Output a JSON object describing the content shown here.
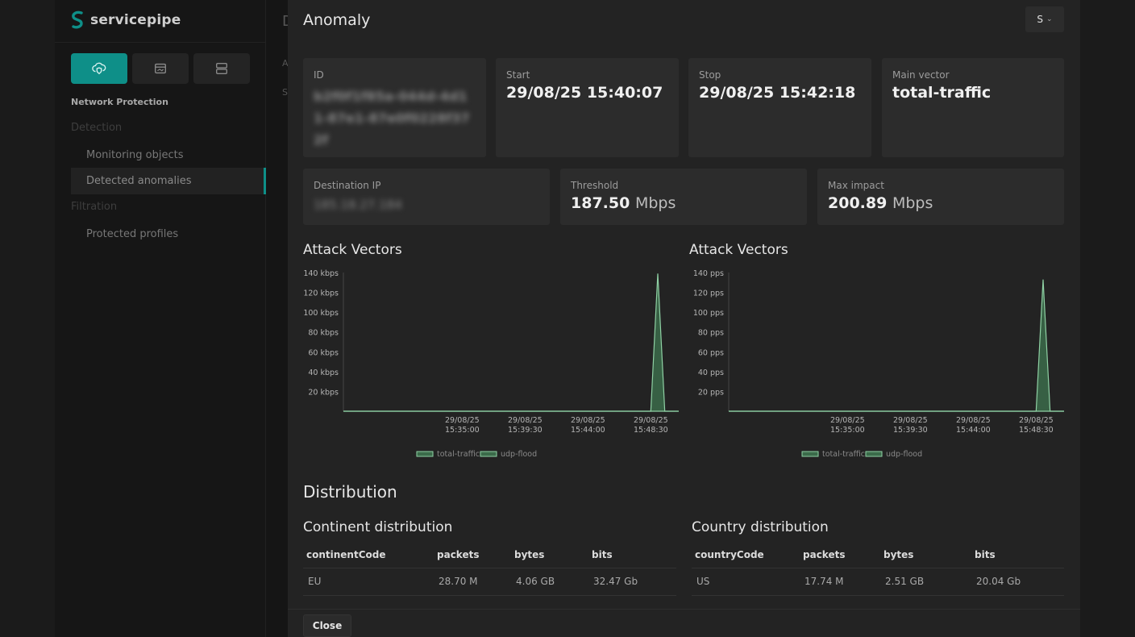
{
  "app": {
    "name": "servicepipe"
  },
  "sidebar": {
    "section_title": "Network Protection",
    "groups": [
      {
        "label": "Detection"
      },
      {
        "label": "Filtration"
      }
    ],
    "items": [
      {
        "label": "Monitoring objects",
        "active": false
      },
      {
        "label": "Detected anomalies",
        "active": true
      },
      {
        "label": "Protected profiles",
        "active": false
      }
    ],
    "nav_icons": [
      "cloud-shield-icon",
      "browser-window-icon",
      "server-icon"
    ]
  },
  "underlay": {
    "title_char": "D",
    "row_chars": [
      "A",
      "S"
    ]
  },
  "modal": {
    "title": "Anomaly",
    "user_initial": "S",
    "cards": {
      "id": {
        "label": "ID",
        "value": "b2f0f1f85a-044d-4d11-87e1-87e0f0228f372f"
      },
      "start": {
        "label": "Start",
        "value": "29/08/25 15:40:07"
      },
      "stop": {
        "label": "Stop",
        "value": "29/08/25 15:42:18"
      },
      "main_vector": {
        "label": "Main vector",
        "value": "total-traffic"
      },
      "destination_ip": {
        "label": "Destination IP",
        "value": "185.18.27.184"
      },
      "threshold": {
        "label": "Threshold",
        "value": "187.50",
        "unit": "Mbps"
      },
      "max_impact": {
        "label": "Max impact",
        "value": "200.89",
        "unit": "Mbps"
      }
    },
    "charts_title_left": "Attack Vectors",
    "charts_title_right": "Attack Vectors",
    "distribution_title": "Distribution",
    "continent": {
      "title": "Continent distribution",
      "columns": [
        "continentCode",
        "packets",
        "bytes",
        "bits"
      ],
      "rows": [
        [
          "EU",
          "28.70 M",
          "4.06 GB",
          "32.47 Gb"
        ]
      ]
    },
    "country": {
      "title": "Country distribution",
      "columns": [
        "countryCode",
        "packets",
        "bytes",
        "bits"
      ],
      "rows": [
        [
          "US",
          "17.74 M",
          "2.51 GB",
          "20.04 Gb"
        ]
      ]
    },
    "close_label": "Close"
  },
  "colors": {
    "accent": "#0e8f88",
    "series": "#8fd1a4",
    "series_fill": "#3b6b4a"
  },
  "chart_data": [
    {
      "type": "area",
      "title": "Attack Vectors",
      "unit": "kbps",
      "ylim": [
        0,
        140
      ],
      "y_ticks": [
        "20 kbps",
        "40 kbps",
        "60 kbps",
        "80 kbps",
        "100 kbps",
        "120 kbps",
        "140 kbps"
      ],
      "x_ticks": [
        [
          "29/08/25",
          "15:35:00"
        ],
        [
          "29/08/25",
          "15:39:30"
        ],
        [
          "29/08/25",
          "15:44:00"
        ],
        [
          "29/08/25",
          "15:48:30"
        ]
      ],
      "x_range_minutes": [
        -8.5,
        15.5
      ],
      "series": [
        {
          "name": "total-traffic",
          "points": [
            [
              -8.5,
              0
            ],
            [
              13.5,
              0
            ],
            [
              14.0,
              139
            ],
            [
              14.5,
              0
            ],
            [
              15.5,
              0
            ]
          ]
        },
        {
          "name": "udp-flood",
          "points": [
            [
              -8.5,
              0
            ],
            [
              15.5,
              0
            ]
          ]
        }
      ],
      "legend": "bottom-center"
    },
    {
      "type": "area",
      "title": "Attack Vectors",
      "unit": "pps",
      "ylim": [
        0,
        140
      ],
      "y_ticks": [
        "20 pps",
        "40 pps",
        "60 pps",
        "80 pps",
        "100 pps",
        "120 pps",
        "140 pps"
      ],
      "x_ticks": [
        [
          "29/08/25",
          "15:35:00"
        ],
        [
          "29/08/25",
          "15:39:30"
        ],
        [
          "29/08/25",
          "15:44:00"
        ],
        [
          "29/08/25",
          "15:48:30"
        ]
      ],
      "x_range_minutes": [
        -8.5,
        15.5
      ],
      "series": [
        {
          "name": "total-traffic",
          "points": [
            [
              -8.5,
              0
            ],
            [
              13.5,
              0
            ],
            [
              14.0,
              133
            ],
            [
              14.5,
              0
            ],
            [
              15.5,
              0
            ]
          ]
        },
        {
          "name": "udp-flood",
          "points": [
            [
              -8.5,
              0
            ],
            [
              15.5,
              0
            ]
          ]
        }
      ],
      "legend": "bottom-center"
    }
  ]
}
